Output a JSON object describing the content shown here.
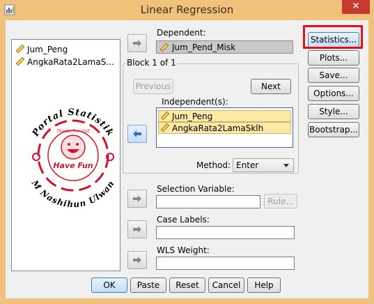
{
  "window": {
    "title": "Linear Regression",
    "close_glyph": "✕"
  },
  "variables": [
    "Jum_Peng",
    "AngkaRata2LamaS..."
  ],
  "dependent": {
    "label": "Dependent:",
    "value": "Jum_Pend_Misk"
  },
  "block": {
    "title": "Block 1 of 1",
    "previous_label": "Previous",
    "next_label": "Next",
    "independents_label": "Independent(s):",
    "independents": [
      "Jum_Peng",
      "AngkaRata2LamaSklh"
    ],
    "method_label": "Method:",
    "method_value": "Enter"
  },
  "selection_variable": {
    "label": "Selection Variable:",
    "value": "",
    "rule_label": "Rule..."
  },
  "case_labels": {
    "label": "Case Labels:",
    "value": ""
  },
  "wls_weight": {
    "label": "WLS Weight:",
    "value": ""
  },
  "side_buttons": [
    "Statistics...",
    "Plots...",
    "Save...",
    "Options...",
    "Style...",
    "Bootstrap..."
  ],
  "bottom_buttons": [
    "OK",
    "Paste",
    "Reset",
    "Cancel",
    "Help"
  ],
  "watermark": {
    "arc_top": "Portal Statistik",
    "arc_bottom": "M Nashihun Ulwan",
    "center": "Have Fun",
    "face_caption": "Thanks For Visit"
  },
  "colors": {
    "frame": "#f0c27b",
    "highlight": "#e0101c",
    "watermark": "#d8102a"
  }
}
